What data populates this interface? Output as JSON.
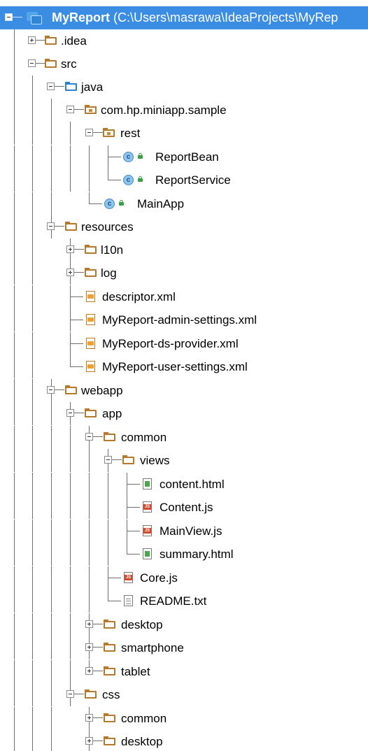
{
  "project_tree": {
    "root": {
      "name": "MyReport",
      "path": "(C:\\Users\\masrawa\\IdeaProjects\\MyRep"
    },
    "items": [
      {
        "label": ".idea",
        "icon": "folder-icon"
      },
      {
        "label": "src",
        "icon": "folder-icon"
      },
      {
        "label": "java",
        "icon": "source-folder-icon"
      },
      {
        "label": "com.hp.miniapp.sample",
        "icon": "package-icon"
      },
      {
        "label": "rest",
        "icon": "package-icon"
      },
      {
        "label": "ReportBean",
        "icon": "class-icon"
      },
      {
        "label": "ReportService",
        "icon": "class-icon"
      },
      {
        "label": "MainApp",
        "icon": "class-icon"
      },
      {
        "label": "resources",
        "icon": "folder-icon"
      },
      {
        "label": "l10n",
        "icon": "folder-icon"
      },
      {
        "label": "log",
        "icon": "folder-icon"
      },
      {
        "label": "descriptor.xml",
        "icon": "xml-file-icon"
      },
      {
        "label": "MyReport-admin-settings.xml",
        "icon": "xml-file-icon"
      },
      {
        "label": "MyReport-ds-provider.xml",
        "icon": "xml-file-icon"
      },
      {
        "label": "MyReport-user-settings.xml",
        "icon": "xml-file-icon"
      },
      {
        "label": "webapp",
        "icon": "folder-icon"
      },
      {
        "label": "app",
        "icon": "folder-icon"
      },
      {
        "label": "common",
        "icon": "folder-icon"
      },
      {
        "label": "views",
        "icon": "folder-icon"
      },
      {
        "label": "content.html",
        "icon": "html-file-icon"
      },
      {
        "label": "Content.js",
        "icon": "js-file-icon"
      },
      {
        "label": "MainView.js",
        "icon": "js-file-icon"
      },
      {
        "label": "summary.html",
        "icon": "html-file-icon"
      },
      {
        "label": "Core.js",
        "icon": "js-file-icon"
      },
      {
        "label": "README.txt",
        "icon": "text-file-icon"
      },
      {
        "label": "desktop",
        "icon": "folder-icon"
      },
      {
        "label": "smartphone",
        "icon": "folder-icon"
      },
      {
        "label": "tablet",
        "icon": "folder-icon"
      },
      {
        "label": "css",
        "icon": "folder-icon"
      },
      {
        "label": "common",
        "icon": "folder-icon"
      },
      {
        "label": "desktop",
        "icon": "folder-icon"
      }
    ]
  },
  "colors": {
    "selection": "#3b8de3",
    "folder": "#b5792c",
    "source_folder": "#2d7fd0",
    "tree_lines": "#6f6f6f"
  }
}
